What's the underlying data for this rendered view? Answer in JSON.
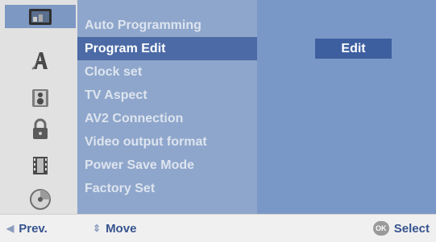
{
  "icons": [
    {
      "name": "tv-screen-icon",
      "active": true
    },
    {
      "name": "language-a-icon",
      "active": false
    },
    {
      "name": "speaker-icon",
      "active": false
    },
    {
      "name": "lock-icon",
      "active": false
    },
    {
      "name": "film-reel-icon",
      "active": false
    },
    {
      "name": "disc-icon",
      "active": false
    }
  ],
  "menu": {
    "items": [
      {
        "label": "Auto Programming"
      },
      {
        "label": "Program Edit"
      },
      {
        "label": "Clock set"
      },
      {
        "label": "TV Aspect"
      },
      {
        "label": "AV2 Connection"
      },
      {
        "label": "Video output format"
      },
      {
        "label": "Power Save Mode"
      },
      {
        "label": "Factory Set"
      }
    ],
    "selected_index": 1
  },
  "value": {
    "label": "Edit"
  },
  "bottom_bar": {
    "prev_label": "Prev.",
    "move_label": "Move",
    "ok_badge": "OK",
    "select_label": "Select"
  },
  "colors": {
    "menu_bg": "#8ea6cb",
    "selected_bg": "#4b6aa6",
    "value_bg": "#7a98c7",
    "value_box": "#3d5fa0",
    "hint_text": "#36548f"
  }
}
